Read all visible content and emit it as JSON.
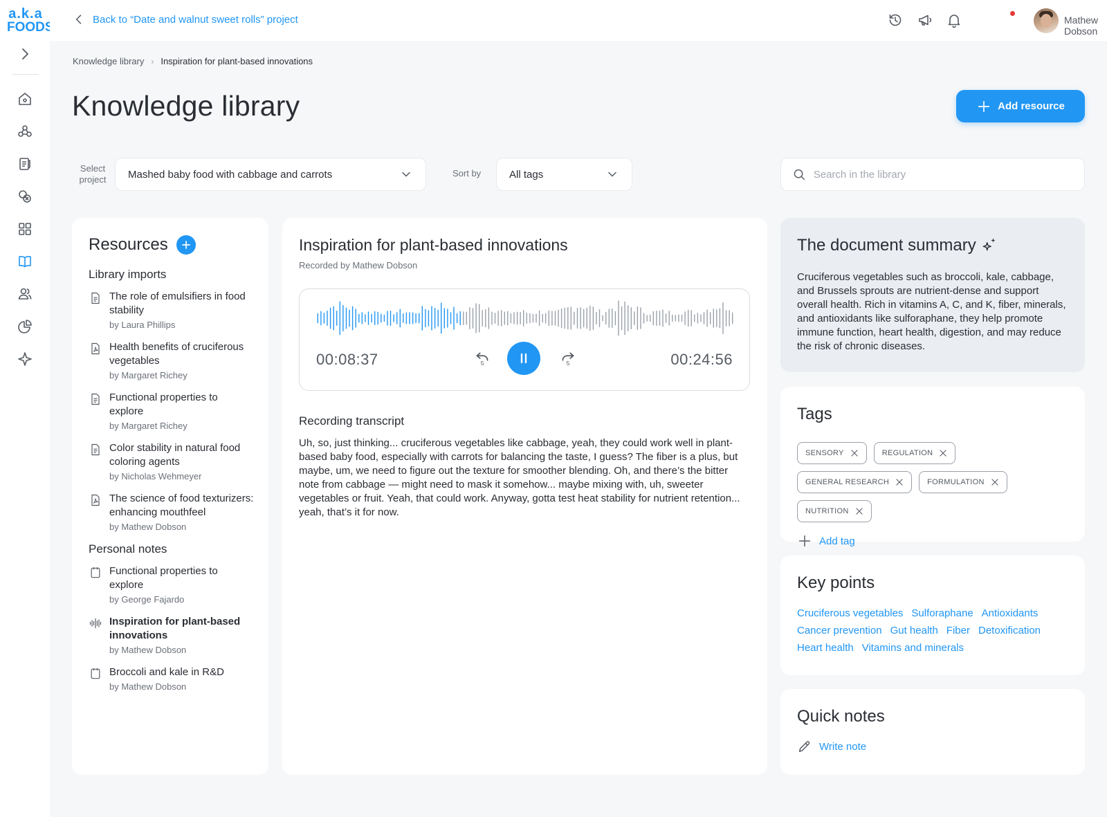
{
  "brand": {
    "line1": "a.k.a",
    "line2": "FOODS",
    "accent": "#2196f3"
  },
  "topbar": {
    "back_label": "Back to “Date and walnut sweet rolls” project",
    "user_name": "Mathew Dobson",
    "icons": [
      "history-icon",
      "megaphone-icon",
      "bell-icon"
    ]
  },
  "sidebar": {
    "items": [
      "home-icon",
      "molecule-icon",
      "recipe-icon",
      "ingredients-icon",
      "dashboard-icon",
      "book-icon",
      "team-icon",
      "analytics-icon",
      "ai-sparkle-icon"
    ]
  },
  "breadcrumb": {
    "root": "Knowledge library",
    "current": "Inspiration for plant-based innovations"
  },
  "page": {
    "title": "Knowledge library",
    "add_resource": "Add resource"
  },
  "filters": {
    "project_label": "Select project",
    "project_value": "Mashed baby food with cabbage and carrots",
    "sort_label": "Sort by",
    "sort_value": "All tags",
    "search_placeholder": "Search in the library"
  },
  "resources": {
    "title": "Resources",
    "library_imports_title": "Library imports",
    "library_imports": [
      {
        "title": "The role of emulsifiers in food stability",
        "author": "by Laura Phillips",
        "icon": "document-icon"
      },
      {
        "title": "Health benefits of cruciferous vegetables",
        "author": "by Margaret Richey",
        "icon": "pdf-icon"
      },
      {
        "title": "Functional properties to explore",
        "author": "by Margaret Richey",
        "icon": "document-icon"
      },
      {
        "title": "Color stability in natural food coloring agents",
        "author": "by Nicholas Wehmeyer",
        "icon": "document-icon"
      },
      {
        "title": "The science of food texturizers: enhancing mouthfeel",
        "author": "by Mathew Dobson",
        "icon": "pdf-icon"
      }
    ],
    "personal_notes_title": "Personal notes",
    "personal_notes": [
      {
        "title": "Functional properties to explore",
        "author": "by George Fajardo",
        "icon": "note-icon"
      },
      {
        "title": "Inspiration for plant-based innovations",
        "author": "by Mathew Dobson",
        "icon": "audio-icon"
      },
      {
        "title": "Broccoli and kale in R&D",
        "author": "by Mathew Dobson",
        "icon": "note-icon"
      }
    ]
  },
  "recording": {
    "title": "Inspiration for plant-based innovations",
    "recorded_by": "Recorded by Mathew Dobson",
    "current_time": "00:08:37",
    "total_time": "00:24:56",
    "progress": 0.345,
    "transcript_title": "Recording transcript",
    "transcript": "Uh, so, just thinking... cruciferous vegetables like cabbage, yeah, they could work well in plant-based baby food, especially with carrots for balancing the taste, I guess? The fiber is a plus, but maybe, um, we need to figure out the texture for smoother blending. Oh, and there’s the bitter note from cabbage — might need to mask it somehow... maybe mixing with, uh, sweeter vegetables or fruit. Yeah, that could work. Anyway, gotta test heat stability for nutrient retention... yeah, that’s it for now."
  },
  "summary": {
    "title": "The document summary",
    "text": "Cruciferous vegetables such as broccoli, kale, cabbage, and Brussels sprouts are nutrient-dense and support overall health. Rich in vitamins A, C, and K, fiber, minerals, and antioxidants like sulforaphane, they help promote immune function, heart health, digestion, and may reduce the risk of chronic diseases."
  },
  "tags": {
    "title": "Tags",
    "items": [
      "SENSORY",
      "REGULATION",
      "GENERAL RESEARCH",
      "FORMULATION",
      "NUTRITION"
    ],
    "add_label": "Add tag"
  },
  "key_points": {
    "title": "Key points",
    "items": [
      "Cruciferous vegetables",
      "Sulforaphane",
      "Antioxidants",
      "Cancer prevention",
      "Gut health",
      "Fiber",
      "Detoxification",
      "Heart health",
      "Vitamins and minerals"
    ]
  },
  "quick_notes": {
    "title": "Quick notes",
    "write_label": "Write note"
  }
}
